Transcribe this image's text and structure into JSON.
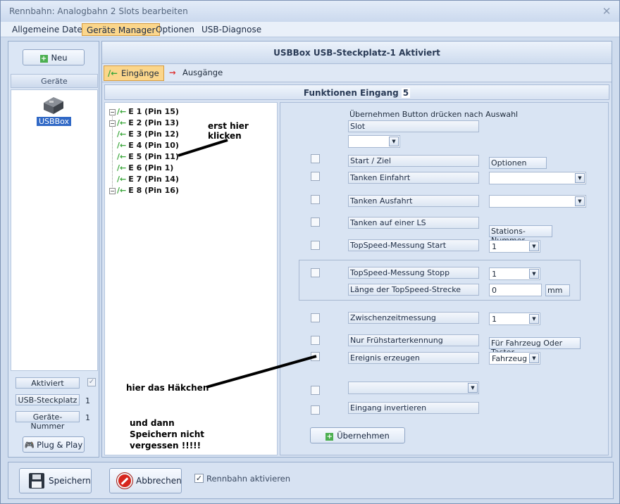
{
  "window": {
    "title": "Rennbahn: Analogbahn 2 Slots bearbeiten",
    "close_glyph": "✕"
  },
  "menu": [
    "Allgemeine Daten",
    "Geräte Manager",
    "Optionen",
    "USB-Diagnose"
  ],
  "left": {
    "new_button": "Neu",
    "devices_header": "Geräte",
    "device_name": "USBBox",
    "activated_label": "Aktiviert",
    "usb_slot_label": "USB-Steckplatz",
    "usb_slot_value": "1",
    "device_number_label": "Geräte-Nummer",
    "device_number_value": "1",
    "plug_play": "Plug & Play"
  },
  "main": {
    "header": "USBBox  USB-Steckplatz-1  Aktiviert",
    "tabs": [
      "Eingänge",
      "Ausgänge"
    ],
    "func_title": "Funktionen Eingang",
    "func_count": "5"
  },
  "tree": [
    {
      "pm": "⊟",
      "label": "E 1 (Pin 15)"
    },
    {
      "pm": "⊟",
      "label": "E 2 (Pin 13)"
    },
    {
      "pm": "",
      "label": "E 3 (Pin 12)"
    },
    {
      "pm": "",
      "label": "E 4 (Pin 10)"
    },
    {
      "pm": "",
      "label": "E 5 (Pin 11)"
    },
    {
      "pm": "",
      "label": "E 6 (Pin 1)"
    },
    {
      "pm": "",
      "label": "E 7 (Pin 14)"
    },
    {
      "pm": "⊟",
      "label": "E 8 (Pin 16)"
    }
  ],
  "form": {
    "instruction": "Übernehmen Button drücken nach Auswahl",
    "slot_label": "Slot",
    "start_ziel": "Start / Ziel",
    "options_button": "Optionen",
    "tanken_einfahrt": "Tanken Einfahrt",
    "tanken_ausfahrt": "Tanken Ausfahrt",
    "tanken_ls": "Tanken auf einer LS",
    "stations_nummer": "Stations-Nummer",
    "topspeed_start": "TopSpeed-Messung Start",
    "topspeed_start_value": "1",
    "topspeed_stopp": "TopSpeed-Messung Stopp",
    "topspeed_stopp_value": "1",
    "laenge": "Länge der TopSpeed-Strecke",
    "laenge_value": "0",
    "unit": "mm",
    "zwischenzeit": "Zwischenzeitmessung",
    "zwischenzeit_value": "1",
    "fruehstarter": "Nur Frühstarterkennung",
    "fahrzeug_taster": "Für Fahrzeug Oder Taster",
    "ereignis": "Ereignis erzeugen",
    "ereignis_value": "Fahrzeug",
    "invertieren": "Eingang invertieren",
    "uebernehmen": "Übernehmen"
  },
  "notes": {
    "click_here": "erst hier klicken",
    "checkmark": "hier das Häkchen",
    "save_line1": "und dann",
    "save_line2": "Speichern nicht",
    "save_line3": "vergessen !!!!!"
  },
  "bottom": {
    "save": "Speichern",
    "cancel": "Abbrechen",
    "activate": "Rennbahn aktivieren"
  }
}
